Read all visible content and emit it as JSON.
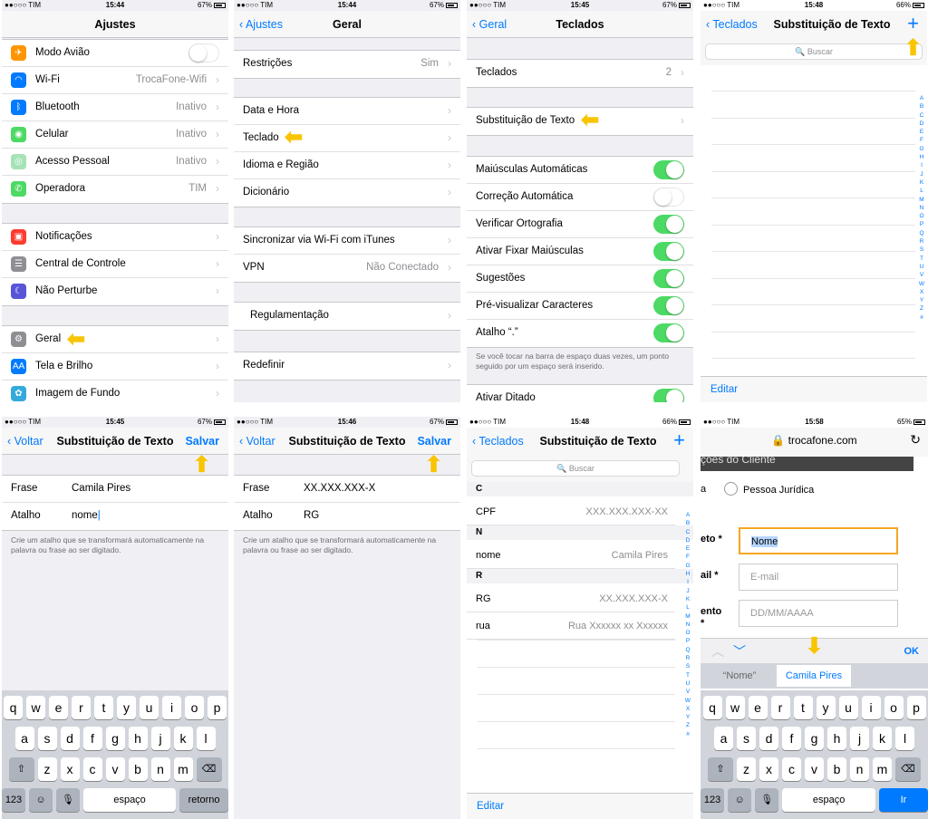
{
  "p1": {
    "status": {
      "carrier": "●●○○○ TIM",
      "time": "15:44",
      "battery": "67%"
    },
    "title": "Ajustes",
    "group1": [
      {
        "label": "Modo Avião",
        "value": "",
        "icon": "airplane-icon",
        "color": "#ff9500",
        "glyph": "✈"
      },
      {
        "label": "Wi-Fi",
        "value": "TrocaFone-Wifi",
        "icon": "wifi-icon",
        "color": "#007aff",
        "glyph": "◠"
      },
      {
        "label": "Bluetooth",
        "value": "Inativo",
        "icon": "bluetooth-icon",
        "color": "#007aff",
        "glyph": "ᛒ"
      },
      {
        "label": "Celular",
        "value": "Inativo",
        "icon": "cellular-icon",
        "color": "#4cd964",
        "glyph": "◉"
      },
      {
        "label": "Acesso Pessoal",
        "value": "Inativo",
        "icon": "hotspot-icon",
        "color": "#a5e3b6",
        "glyph": "◎"
      },
      {
        "label": "Operadora",
        "value": "TIM",
        "icon": "phone-icon",
        "color": "#4cd964",
        "glyph": "✆"
      }
    ],
    "group2": [
      {
        "label": "Notificações",
        "icon": "notifications-icon",
        "color": "#ff3b30",
        "glyph": "▣"
      },
      {
        "label": "Central de Controle",
        "icon": "control-center-icon",
        "color": "#8e8e93",
        "glyph": "☰"
      },
      {
        "label": "Não Perturbe",
        "icon": "moon-icon",
        "color": "#5856d6",
        "glyph": "☾"
      }
    ],
    "group3": [
      {
        "label": "Geral",
        "icon": "gear-icon",
        "color": "#8e8e93",
        "glyph": "⚙"
      },
      {
        "label": "Tela e Brilho",
        "icon": "display-icon",
        "color": "#007aff",
        "glyph": "AA"
      },
      {
        "label": "Imagem de Fundo",
        "icon": "wallpaper-icon",
        "color": "#34aadc",
        "glyph": "✿"
      }
    ]
  },
  "p2": {
    "status": {
      "carrier": "●●○○○ TIM",
      "time": "15:44",
      "battery": "67%"
    },
    "back": "Ajustes",
    "title": "Geral",
    "g1": [
      {
        "label": "Restrições",
        "value": "Sim"
      }
    ],
    "g2": [
      {
        "label": "Data e Hora"
      },
      {
        "label": "Teclado"
      },
      {
        "label": "Idioma e Região"
      },
      {
        "label": "Dicionário"
      }
    ],
    "g3": [
      {
        "label": "Sincronizar via Wi-Fi com iTunes"
      },
      {
        "label": "VPN",
        "value": "Não Conectado"
      }
    ],
    "g4": [
      {
        "label": "Regulamentação"
      }
    ],
    "g5": [
      {
        "label": "Redefinir"
      }
    ]
  },
  "p3": {
    "status": {
      "carrier": "●●○○○ TIM",
      "time": "15:45",
      "battery": "67%"
    },
    "back": "Geral",
    "title": "Teclados",
    "g1": [
      {
        "label": "Teclados",
        "value": "2"
      }
    ],
    "g2": [
      {
        "label": "Substituição de Texto"
      }
    ],
    "g3": [
      {
        "label": "Maiúsculas Automáticas",
        "on": true
      },
      {
        "label": "Correção Automática",
        "on": false
      },
      {
        "label": "Verificar Ortografia",
        "on": true
      },
      {
        "label": "Ativar Fixar Maiúsculas",
        "on": true
      },
      {
        "label": "Sugestões",
        "on": true
      },
      {
        "label": "Pré-visualizar Caracteres",
        "on": true
      },
      {
        "label": "Atalho “.”",
        "on": true
      }
    ],
    "footnote": "Se você tocar na barra de espaço duas vezes, um ponto seguido por um espaço será inserido.",
    "g4": [
      {
        "label": "Ativar Ditado",
        "on": true
      }
    ]
  },
  "p4": {
    "status": {
      "carrier": "●●○○○ TIM",
      "time": "15:48",
      "battery": "66%"
    },
    "back": "Teclados",
    "title": "Substituição de Texto",
    "plus": "+",
    "search": "Buscar",
    "index": [
      "A",
      "B",
      "C",
      "D",
      "E",
      "F",
      "G",
      "H",
      "I",
      "J",
      "K",
      "L",
      "M",
      "N",
      "O",
      "P",
      "Q",
      "R",
      "S",
      "T",
      "U",
      "V",
      "W",
      "X",
      "Y",
      "Z",
      "#"
    ],
    "edit": "Editar"
  },
  "p5": {
    "status": {
      "carrier": "●●○○○ TIM",
      "time": "15:45",
      "battery": "67%"
    },
    "back": "Voltar",
    "title": "Substituição de Texto",
    "save": "Salvar",
    "phrase_label": "Frase",
    "phrase": "Camila Pires",
    "shortcut_label": "Atalho",
    "shortcut": "nome",
    "footnote": "Crie um atalho que se transformará automaticamente na palavra ou frase ao ser digitado.",
    "keys": {
      "row1": [
        "q",
        "w",
        "e",
        "r",
        "t",
        "y",
        "u",
        "i",
        "o",
        "p"
      ],
      "row2": [
        "a",
        "s",
        "d",
        "f",
        "g",
        "h",
        "j",
        "k",
        "l"
      ],
      "row3": [
        "z",
        "x",
        "c",
        "v",
        "b",
        "n",
        "m"
      ],
      "num": "123",
      "space": "espaço",
      "return": "retorno"
    }
  },
  "p6": {
    "status": {
      "carrier": "●●○○○ TIM",
      "time": "15:46",
      "battery": "67%"
    },
    "back": "Voltar",
    "title": "Substituição de Texto",
    "save": "Salvar",
    "phrase_label": "Frase",
    "phrase": "XX.XXX.XXX-X",
    "shortcut_label": "Atalho",
    "shortcut": "RG",
    "footnote": "Crie um atalho que se transformará automaticamente na palavra ou frase ao ser digitado."
  },
  "p7": {
    "status": {
      "carrier": "●●○○○ TIM",
      "time": "15:48",
      "battery": "66%"
    },
    "back": "Teclados",
    "title": "Substituição de Texto",
    "plus": "+",
    "search": "Buscar",
    "sections": [
      {
        "letter": "C",
        "items": [
          {
            "shortcut": "CPF",
            "phrase": "XXX.XXX.XXX-XX"
          }
        ]
      },
      {
        "letter": "N",
        "items": [
          {
            "shortcut": "nome",
            "phrase": "Camila Pires"
          }
        ]
      },
      {
        "letter": "R",
        "items": [
          {
            "shortcut": "RG",
            "phrase": "XX.XXX.XXX-X"
          },
          {
            "shortcut": "rua",
            "phrase": "Rua Xxxxxx xx Xxxxxx"
          }
        ]
      }
    ],
    "edit": "Editar"
  },
  "p8": {
    "status": {
      "carrier": "●●○○○ TIM",
      "time": "15:58",
      "battery": "65%"
    },
    "url": "trocafone.com",
    "header_partial": "ções do Cliente",
    "left_partial_a": "a",
    "radio_label": "Pessoa Jurídica",
    "fields": [
      {
        "label": "eto *",
        "placeholder": "Nome"
      },
      {
        "label": "ail *",
        "placeholder": "E-mail"
      },
      {
        "label": "ento *",
        "placeholder": "DD/MM/AAAA"
      }
    ],
    "ok": "OK",
    "suggestions": [
      "“Nome”",
      "Camila Pires"
    ],
    "go": "Ir"
  }
}
